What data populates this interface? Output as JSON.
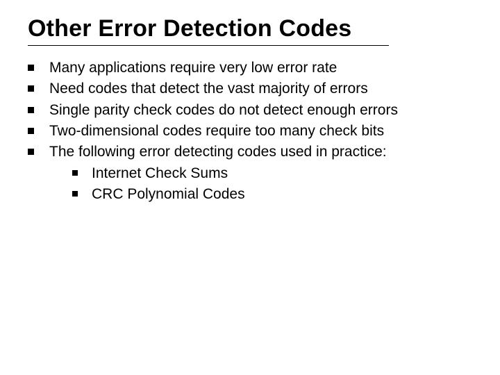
{
  "title": "Other Error Detection Codes",
  "bullets": [
    {
      "text": "Many applications require very low error rate"
    },
    {
      "text": "Need codes that detect the vast majority of errors"
    },
    {
      "text": "Single parity check codes do not detect enough errors"
    },
    {
      "text": "Two-dimensional codes require too many check bits"
    },
    {
      "text": "The following error detecting codes used in practice:"
    }
  ],
  "sub_bullets": [
    {
      "text": "Internet Check Sums"
    },
    {
      "text": "CRC Polynomial Codes"
    }
  ]
}
